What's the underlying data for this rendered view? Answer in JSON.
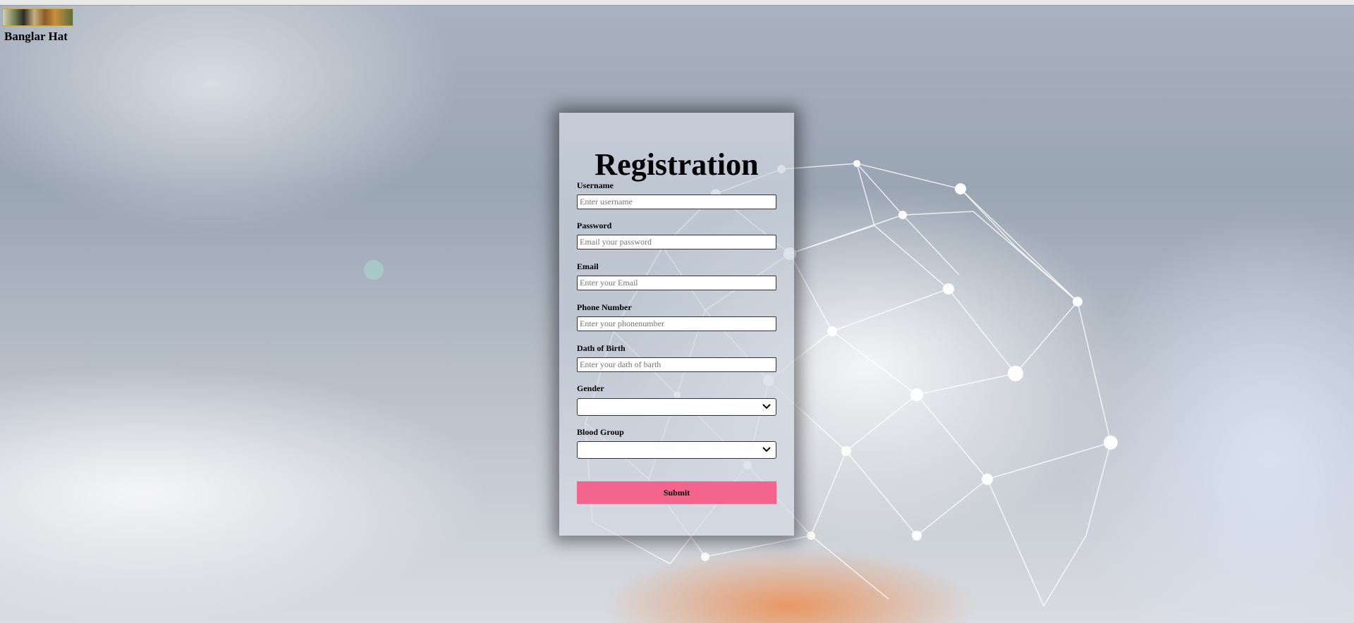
{
  "brand": {
    "name": "Banglar Hat",
    "logo_icon": "banglar-hat-logo"
  },
  "form": {
    "title": "Registration",
    "fields": [
      {
        "label": "Username",
        "placeholder": "Enter username"
      },
      {
        "label": "Password",
        "placeholder": "Email your password"
      },
      {
        "label": "Email",
        "placeholder": "Enter your Email"
      },
      {
        "label": "Phone Number",
        "placeholder": "Enter your phonenumber"
      },
      {
        "label": "Dath of Birth",
        "placeholder": "Enter your dath of barth"
      }
    ],
    "gender": {
      "label": "Gender",
      "value": ""
    },
    "blood_group": {
      "label": "Blood Group",
      "value": ""
    },
    "submit_label": "Submit"
  },
  "colors": {
    "submit_button": "#f4648c",
    "card_shadow": "#000000"
  }
}
